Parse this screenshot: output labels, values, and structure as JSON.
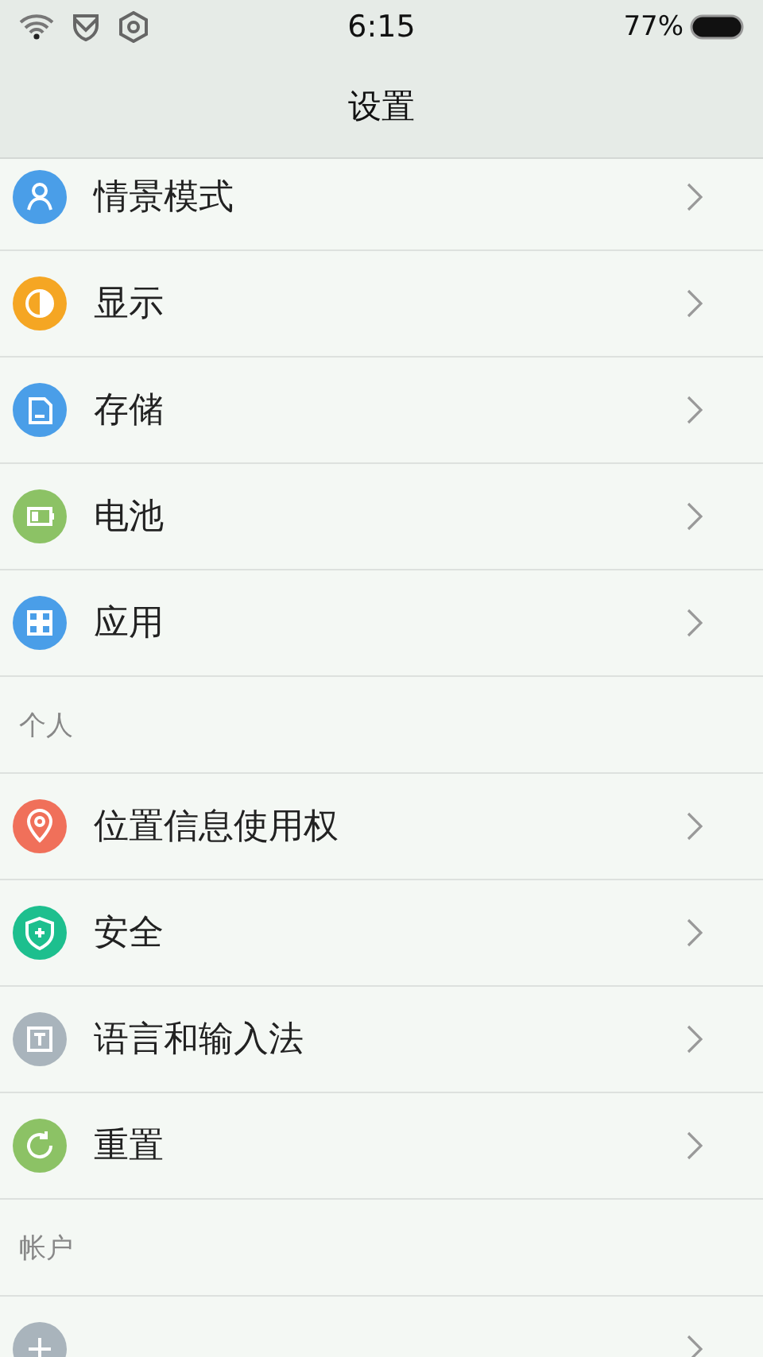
{
  "status_bar": {
    "time": "6:15",
    "battery": "77%"
  },
  "title": "设置",
  "sections": [
    {
      "items": [
        {
          "label": "情景模式",
          "kind": "profile",
          "color": "#4a9ee8"
        },
        {
          "label": "显示",
          "kind": "display",
          "color": "#f5a623"
        },
        {
          "label": "存储",
          "kind": "storage",
          "color": "#4a9ee8"
        },
        {
          "label": "电池",
          "kind": "battery",
          "color": "#8cc265"
        },
        {
          "label": "应用",
          "kind": "apps",
          "color": "#4a9ee8"
        }
      ]
    },
    {
      "header": "个人",
      "items": [
        {
          "label": "位置信息使用权",
          "kind": "location",
          "color": "#f0705a"
        },
        {
          "label": "安全",
          "kind": "security",
          "color": "#1dbf8e"
        },
        {
          "label": "语言和输入法",
          "kind": "language",
          "color": "#a9b4bc"
        },
        {
          "label": "重置",
          "kind": "reset",
          "color": "#8cc265"
        }
      ]
    },
    {
      "header": "帐户",
      "items": [
        {
          "kind": "add",
          "color": "#a9b4bc"
        }
      ]
    }
  ]
}
